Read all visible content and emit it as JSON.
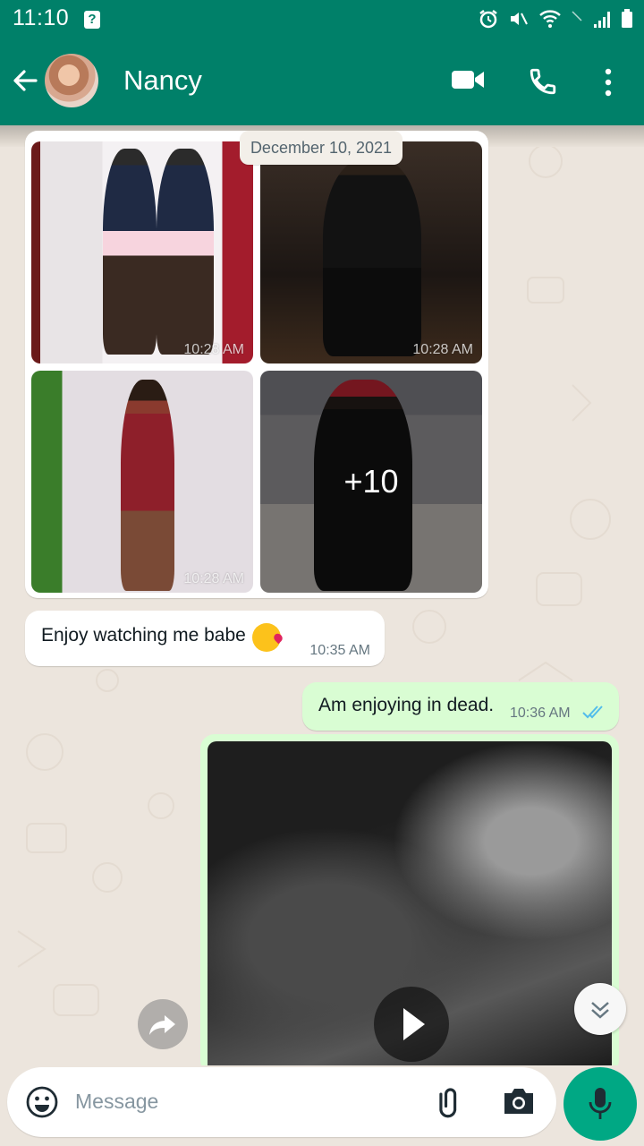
{
  "status_bar": {
    "time": "11:10"
  },
  "header": {
    "contact_name": "Nancy"
  },
  "chat": {
    "date_chip": "December 10, 2021",
    "album": {
      "photos": [
        {
          "time": "10:28 AM"
        },
        {
          "time": "10:28 AM"
        },
        {
          "time": "10:28 AM"
        },
        {
          "more_count": "+10"
        }
      ]
    },
    "messages": [
      {
        "direction": "incoming",
        "text": "Enjoy watching me babe",
        "time": "10:35 AM"
      },
      {
        "direction": "outgoing",
        "text": "Am enjoying in dead.",
        "time": "10:36 AM",
        "status": "read"
      }
    ]
  },
  "composer": {
    "placeholder": "Message"
  },
  "colors": {
    "header": "#008069",
    "accent": "#00a884",
    "outgoing_bubble": "#d9fdd3",
    "read_ticks": "#53bdeb"
  }
}
